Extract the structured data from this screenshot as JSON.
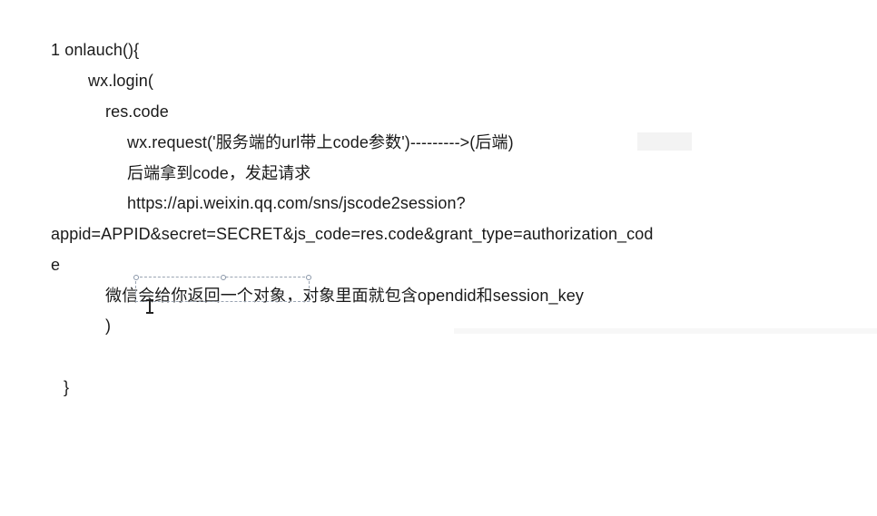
{
  "document": {
    "lines": [
      "1 onlauch(){",
      "wx.login(",
      "res.code",
      "wx.request('服务端的url带上code参数')--------->(后端)",
      "后端拿到code，发起请求",
      "https://api.weixin.qq.com/sns/jscode2session?",
      "appid=APPID&secret=SECRET&js_code=res.code&grant_type=authorization_cod",
      "e",
      "微信会给你返回一个对象，对象里面就包含opendid和session_key",
      ")",
      "}"
    ]
  }
}
